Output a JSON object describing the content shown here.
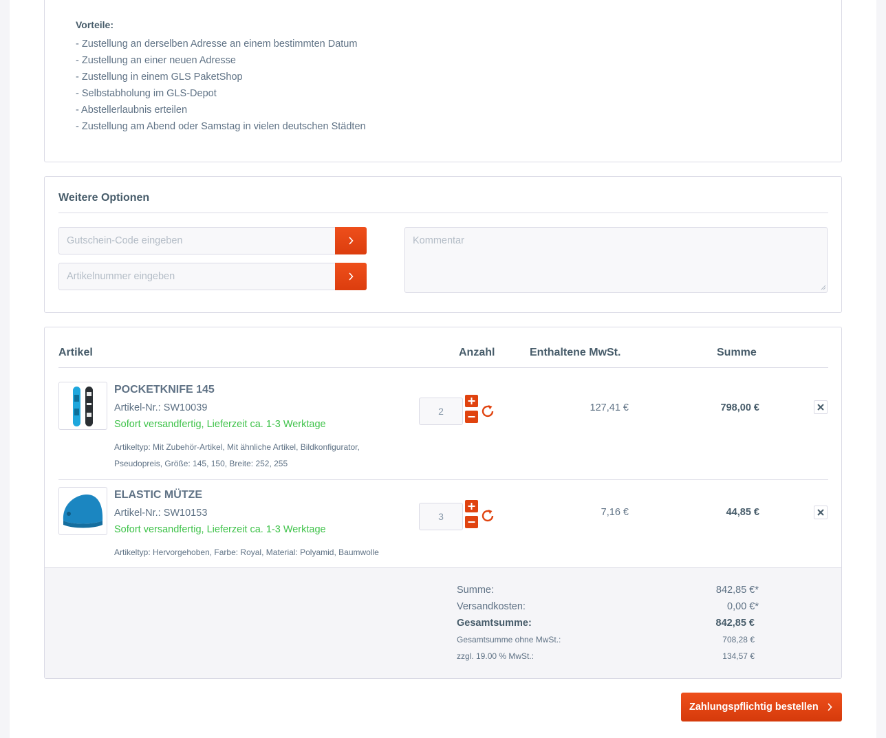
{
  "advantages": {
    "title": "Vorteile:",
    "items": [
      "- Zustellung an derselben Adresse an einem bestimmten Datum",
      "- Zustellung an einer neuen Adresse",
      "- Zustellung in einem GLS PaketShop",
      "- Selbstabholung im GLS-Depot",
      "- Abstellerlaubnis erteilen",
      "- Zustellung am Abend oder Samstag in vielen deutschen Städten"
    ]
  },
  "options": {
    "title": "Weitere Optionen",
    "voucher_placeholder": "Gutschein-Code eingeben",
    "article_placeholder": "Artikelnummer eingeben",
    "comment_placeholder": "Kommentar",
    "submit_icon": "chevron-right-icon"
  },
  "cart": {
    "headers": {
      "article": "Artikel",
      "quantity": "Anzahl",
      "tax": "Enthaltene MwSt.",
      "sum": "Summe"
    },
    "items": [
      {
        "name": "POCKETKNIFE 145",
        "number": "Artikel-Nr.: SW10039",
        "delivery": "Sofort versandfertig, Lieferzeit ca. 1-3 Werktage",
        "attributes": "Artikeltyp: Mit Zubehör-Artikel, Mit ähnliche Artikel, Bildkonfigurator, Pseudopreis, Größe: 145, 150, Breite: 252, 255",
        "quantity": "2",
        "tax": "127,41 €",
        "sum": "798,00 €",
        "image": "snowboard-image"
      },
      {
        "name": "ELASTIC MÜTZE",
        "number": "Artikel-Nr.: SW10153",
        "delivery": "Sofort versandfertig, Lieferzeit ca. 1-3 Werktage",
        "attributes": "Artikeltyp: Hervorgehoben, Farbe: Royal, Material: Polyamid, Baumwolle",
        "quantity": "3",
        "tax": "7,16 €",
        "sum": "44,85 €",
        "image": "beanie-image"
      }
    ],
    "totals": {
      "subtotal_label": "Summe:",
      "subtotal_value": "842,85 €*",
      "shipping_label": "Versandkosten:",
      "shipping_value": "0,00 €*",
      "total_label": "Gesamtsumme:",
      "total_value": "842,85 €",
      "net_label": "Gesamtsumme ohne MwSt.:",
      "net_value": "708,28 €",
      "vat_label": "zzgl. 19.00 % MwSt.:",
      "vat_value": "134,57 €"
    }
  },
  "order_button": {
    "label": "Zahlungspflichtig bestellen"
  },
  "colors": {
    "accent": "#e0430f",
    "delivery_green": "#3ec249",
    "text": "#5f7285",
    "heading": "#475c6a"
  }
}
